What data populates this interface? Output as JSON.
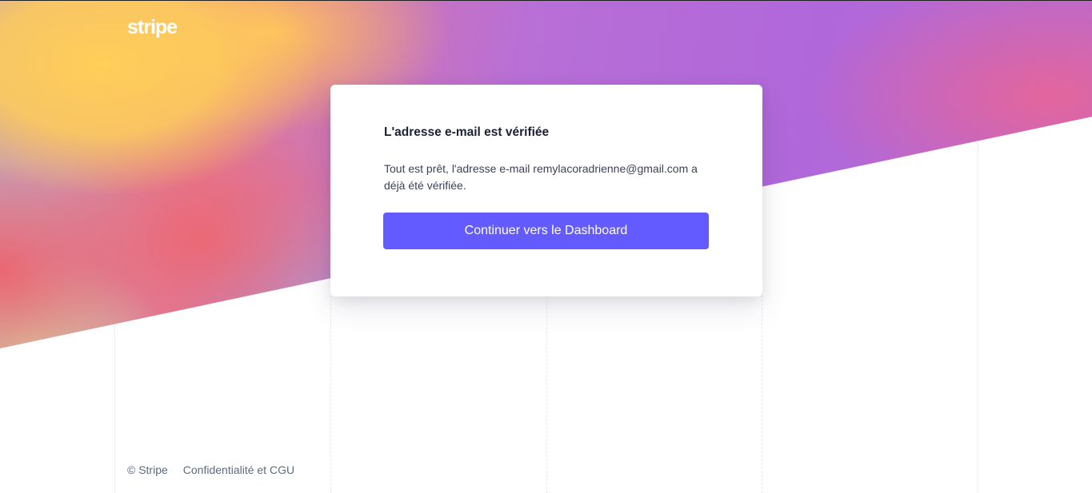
{
  "brand": {
    "logo_text": "stripe"
  },
  "card": {
    "title": "L'adresse e-mail est vérifiée",
    "message": "Tout est prêt, l'adresse e-mail remylacoradrienne@gmail.com a déjà été vérifiée.",
    "button_label": "Continuer vers le Dashboard"
  },
  "footer": {
    "copyright": "© Stripe",
    "privacy_link": "Confidentialité et CGU"
  },
  "colors": {
    "accent": "#635bff",
    "title": "#1a1f36",
    "body_text": "#3c4257",
    "footer_text": "#5e6a7e"
  }
}
